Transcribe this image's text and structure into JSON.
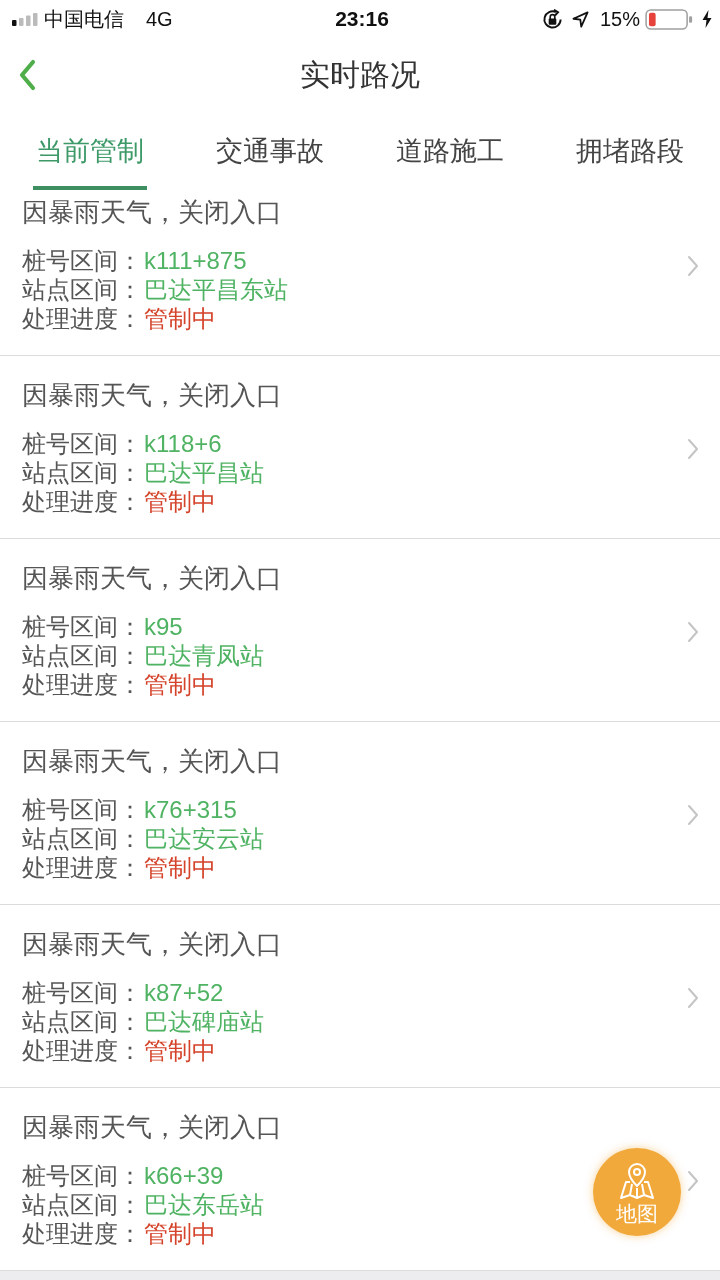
{
  "status_bar": {
    "carrier": "中国电信",
    "network": "4G",
    "time": "23:16",
    "battery_percent": "15%"
  },
  "nav": {
    "title": "实时路况"
  },
  "tabs": [
    {
      "label": "当前管制",
      "selected": true
    },
    {
      "label": "交通事故",
      "selected": false
    },
    {
      "label": "道路施工",
      "selected": false
    },
    {
      "label": "拥堵路段",
      "selected": false
    }
  ],
  "incidents": [
    {
      "title": "因暴雨天气，关闭入口",
      "fields": [
        {
          "kind": "range",
          "label": "桩号区间：",
          "value": "k111+875"
        },
        {
          "kind": "range",
          "label": "站点区间：",
          "value": "巴达平昌东站"
        },
        {
          "kind": "status",
          "label": "处理进度：",
          "value": "管制中"
        }
      ]
    },
    {
      "title": "因暴雨天气，关闭入口",
      "fields": [
        {
          "kind": "range",
          "label": "桩号区间：",
          "value": "k118+6"
        },
        {
          "kind": "range",
          "label": "站点区间：",
          "value": "巴达平昌站"
        },
        {
          "kind": "status",
          "label": "处理进度：",
          "value": "管制中"
        }
      ]
    },
    {
      "title": "因暴雨天气，关闭入口",
      "fields": [
        {
          "kind": "range",
          "label": "桩号区间：",
          "value": "k95"
        },
        {
          "kind": "range",
          "label": "站点区间：",
          "value": "巴达青凤站"
        },
        {
          "kind": "status",
          "label": "处理进度：",
          "value": "管制中"
        }
      ]
    },
    {
      "title": "因暴雨天气，关闭入口",
      "fields": [
        {
          "kind": "range",
          "label": "桩号区间：",
          "value": "k76+315"
        },
        {
          "kind": "range",
          "label": "站点区间：",
          "value": "巴达安云站"
        },
        {
          "kind": "status",
          "label": "处理进度：",
          "value": "管制中"
        }
      ]
    },
    {
      "title": "因暴雨天气，关闭入口",
      "fields": [
        {
          "kind": "range",
          "label": "桩号区间：",
          "value": "k87+52"
        },
        {
          "kind": "range",
          "label": "站点区间：",
          "value": "巴达碑庙站"
        },
        {
          "kind": "status",
          "label": "处理进度：",
          "value": "管制中"
        }
      ]
    },
    {
      "title": "因暴雨天气，关闭入口",
      "fields": [
        {
          "kind": "range",
          "label": "桩号区间：",
          "value": "k66+39"
        },
        {
          "kind": "range",
          "label": "站点区间：",
          "value": "巴达东岳站"
        },
        {
          "kind": "status",
          "label": "处理进度：",
          "value": "管制中"
        }
      ]
    }
  ],
  "map_button": {
    "label": "地图"
  }
}
